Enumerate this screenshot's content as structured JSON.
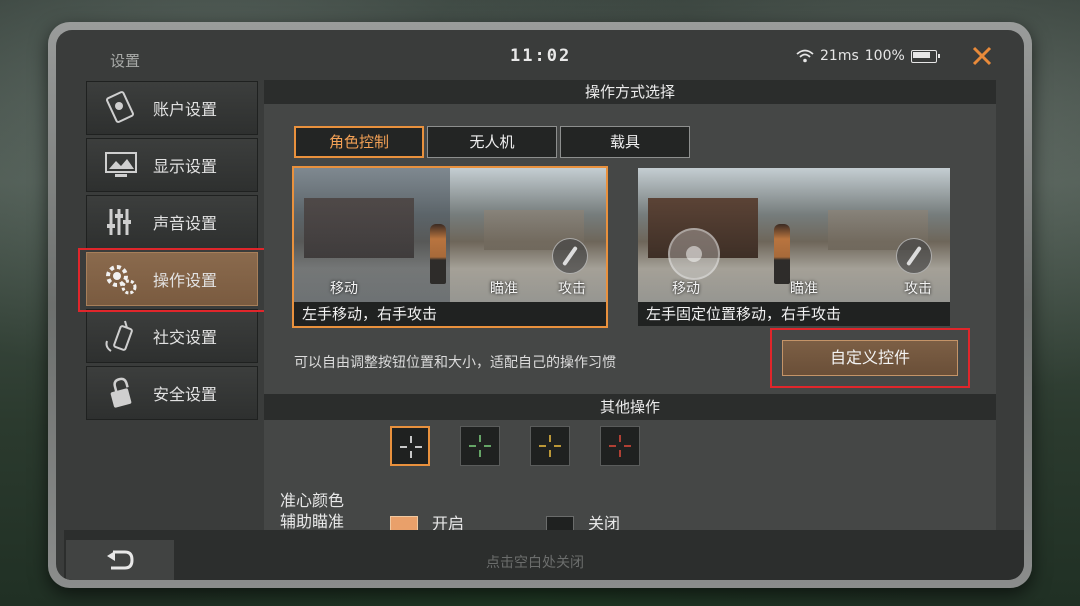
{
  "status": {
    "title": "设置",
    "time": "11:02",
    "ping": "21ms",
    "battery": "100%"
  },
  "sidebar": {
    "items": [
      {
        "label": "账户设置",
        "icon": "account-card-icon"
      },
      {
        "label": "显示设置",
        "icon": "monitor-icon"
      },
      {
        "label": "声音设置",
        "icon": "equalizer-icon"
      },
      {
        "label": "操作设置",
        "icon": "gear-icon"
      },
      {
        "label": "社交设置",
        "icon": "walkie-talkie-icon"
      },
      {
        "label": "安全设置",
        "icon": "lock-icon"
      }
    ],
    "active_index": 3
  },
  "control_section": {
    "header": "操作方式选择",
    "tabs": [
      "角色控制",
      "无人机",
      "载具"
    ],
    "active_tab": 0,
    "modes": [
      {
        "move": "移动",
        "aim": "瞄准",
        "attack": "攻击",
        "caption": "左手移动，右手攻击",
        "selected": true
      },
      {
        "move": "移动",
        "aim": "瞄准",
        "attack": "攻击",
        "caption": "左手固定位置移动，右手攻击",
        "selected": false
      }
    ],
    "hint": "可以自由调整按钮位置和大小，适配自己的操作习惯",
    "custom_button": "自定义控件"
  },
  "other_section": {
    "header": "其他操作",
    "crosshair_label": "准心颜色",
    "crosshair_colors": [
      "#ffffff",
      "#7fd17f",
      "#f0c040",
      "#e04a3a"
    ],
    "crosshair_active": 0,
    "assist_label": "辅助瞄准",
    "assist_on": "开启",
    "assist_off": "关闭"
  },
  "footer": {
    "close_hint": "点击空白处关闭"
  },
  "colors": {
    "accent": "#e9913d",
    "highlight_red": "#e0262b"
  }
}
